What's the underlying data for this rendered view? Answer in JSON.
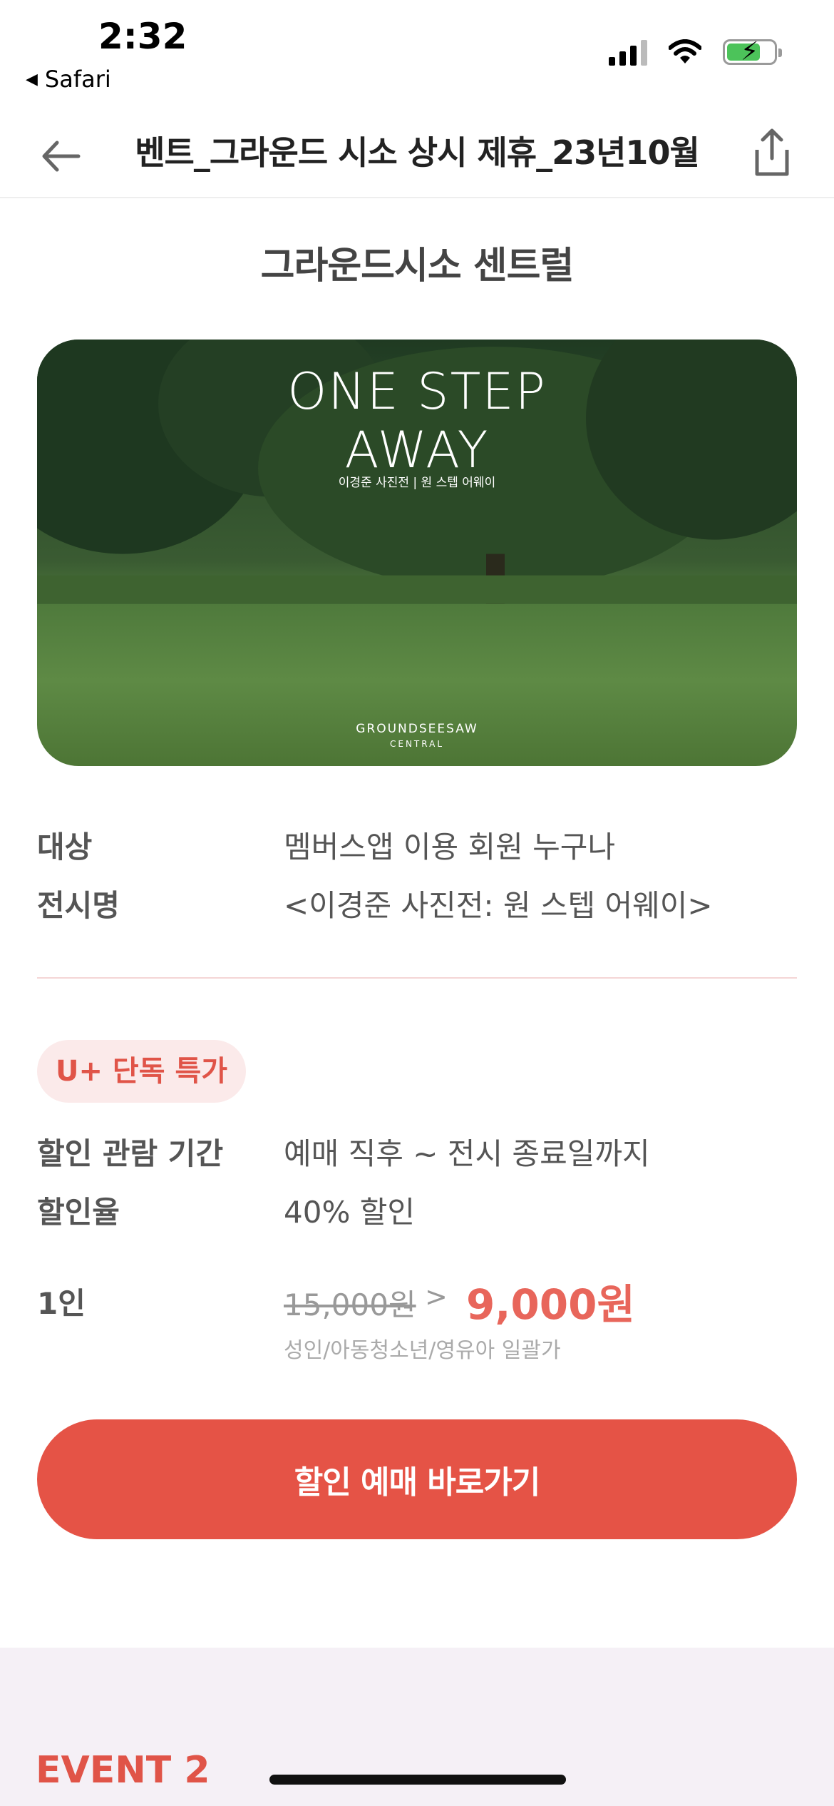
{
  "status_bar": {
    "time": "2:32",
    "back_app": "Safari"
  },
  "header": {
    "title": "벤트_그라운드 시소 상시 제휴_23년10월"
  },
  "venue": {
    "title": "그라운드시소 센트럴"
  },
  "hero": {
    "title_line1": "ONE STEP",
    "title_line2": "AWAY",
    "subtitle": "이경준 사진전 | 원 스텝 어웨이",
    "brand": "GROUNDSEESAW",
    "brand_sub": "CENTRAL"
  },
  "info": [
    {
      "label": "대상",
      "value": "멤버스앱 이용 회원 누구나"
    },
    {
      "label": "전시명",
      "value": "<이경준 사진전: 원 스텝 어웨이>"
    }
  ],
  "offer": {
    "badge": "U+ 단독 특가",
    "period_label": "할인 관람 기간",
    "period_value": "예매 직후 ~ 전시 종료일까지",
    "rate_label": "할인율",
    "rate_value": "40% 할인",
    "price_label": "1인",
    "price_old": "15,000원",
    "price_arrow": ">",
    "price_new": "9,000원",
    "price_note": "성인/아동청소년/영유아 일괄가"
  },
  "cta": {
    "label": "할인 예매 바로가기"
  },
  "next_section": {
    "label": "EVENT 2"
  }
}
